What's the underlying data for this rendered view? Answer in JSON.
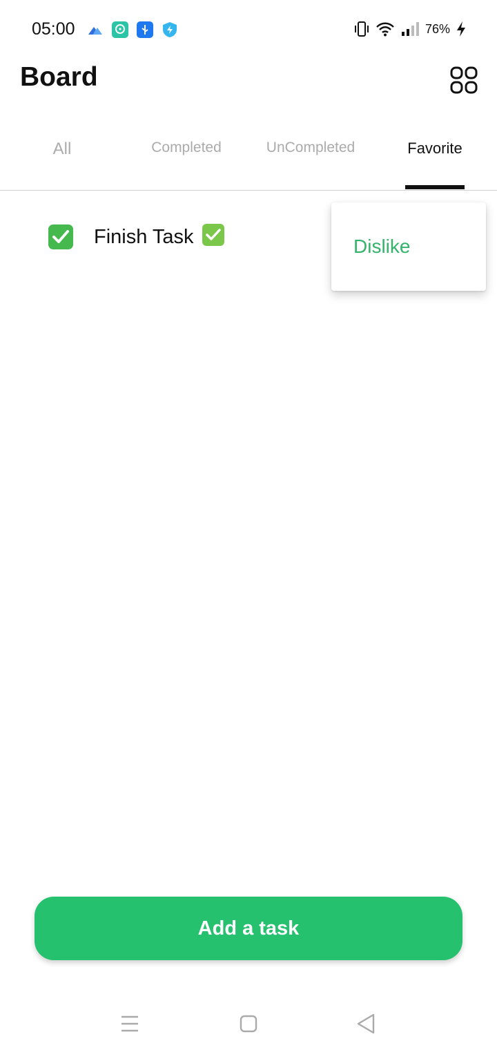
{
  "status_bar": {
    "time": "05:00",
    "battery": "76%",
    "left_icons": [
      "kite-app-icon",
      "chat-app-icon",
      "usb-icon",
      "shield-icon"
    ],
    "right_icons": [
      "vibrate-icon",
      "wifi-icon",
      "signal-icon",
      "charging-icon"
    ]
  },
  "header": {
    "title": "Board",
    "grid_icon": "grid-icon"
  },
  "tabs": [
    {
      "label": "All",
      "selected": false
    },
    {
      "label": "Completed",
      "selected": false
    },
    {
      "label": "UnCompleted",
      "selected": false
    },
    {
      "label": "Favorite",
      "selected": true
    }
  ],
  "tasks": [
    {
      "title": "Finish Task",
      "emoji": "✅",
      "completed": true
    }
  ],
  "popup_menu": {
    "items": [
      "Dislike"
    ]
  },
  "add_button": {
    "label": "Add a task"
  },
  "colors": {
    "accent_green": "#25c16f",
    "checkbox_green": "#46b94e",
    "popup_text_green": "#33b36b",
    "inactive_tab": "#ababab"
  }
}
